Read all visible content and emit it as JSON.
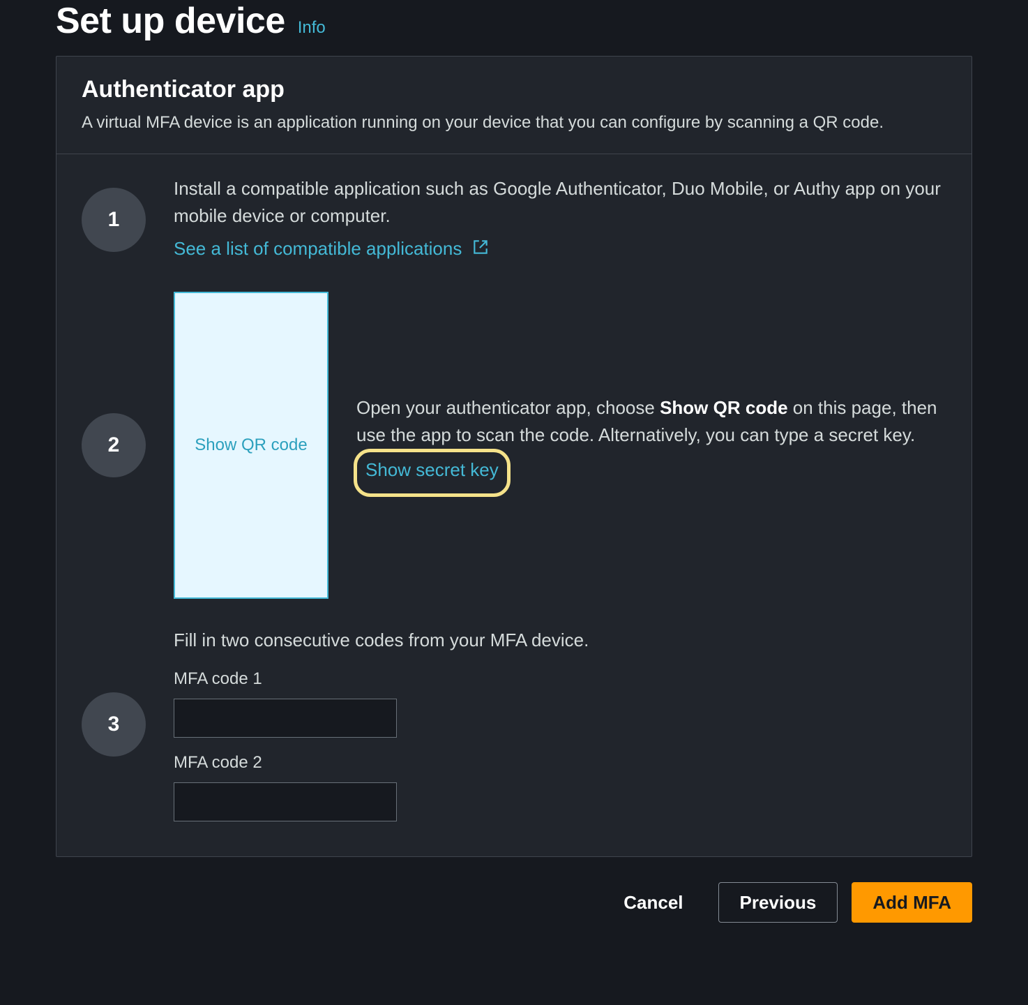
{
  "header": {
    "title": "Set up device",
    "info_label": "Info"
  },
  "panel": {
    "title": "Authenticator app",
    "subtitle": "A virtual MFA device is an application running on your device that you can configure by scanning a QR code."
  },
  "steps": {
    "s1": {
      "num": "1",
      "text": "Install a compatible application such as Google Authenticator, Duo Mobile, or Authy app on your mobile device or computer.",
      "link_label": "See a list of compatible applications"
    },
    "s2": {
      "num": "2",
      "qr_label": "Show QR code",
      "text_a": "Open your authenticator app, choose ",
      "bold": "Show QR code",
      "text_b": " on this page, then use the app to scan the code. Alternatively, you can type a secret key. ",
      "secret_link": "Show secret key"
    },
    "s3": {
      "num": "3",
      "lead": "Fill in two consecutive codes from your MFA device.",
      "label1": "MFA code 1",
      "label2": "MFA code 2",
      "value1": "",
      "value2": ""
    }
  },
  "footer": {
    "cancel": "Cancel",
    "previous": "Previous",
    "submit": "Add MFA"
  }
}
